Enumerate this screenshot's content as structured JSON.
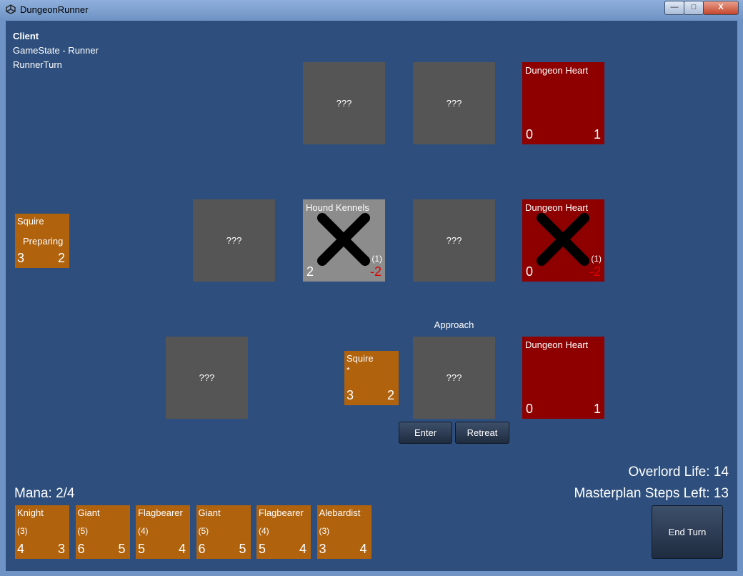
{
  "window": {
    "title": "DungeonRunner",
    "minimize": "—",
    "maximize": "□",
    "close": "X"
  },
  "hud": {
    "client": "Client",
    "game_state": "GameState - Runner",
    "turn": "RunnerTurn"
  },
  "rooms": {
    "r1c1": "???",
    "r1c2": "???",
    "r2c0": "???",
    "r2c2": "???",
    "r3c0": "???",
    "r3c2": "???",
    "hound_kennels": {
      "name": "Hound Kennels",
      "left": "2",
      "right": "-2",
      "extra": "(1)"
    },
    "heart_top": {
      "name": "Dungeon Heart",
      "left": "0",
      "right": "1"
    },
    "heart_mid": {
      "name": "Dungeon Heart",
      "left": "0",
      "right": "-2",
      "extra": "(1)"
    },
    "heart_bot": {
      "name": "Dungeon Heart",
      "left": "0",
      "right": "1"
    }
  },
  "prep_card": {
    "name": "Squire",
    "status": "Preparing",
    "left": "3",
    "right": "2"
  },
  "runner_card": {
    "name": "Squire",
    "mark": "*",
    "left": "3",
    "right": "2"
  },
  "approach_label": "Approach",
  "buttons": {
    "enter": "Enter",
    "retreat": "Retreat",
    "end_turn": "End Turn"
  },
  "stats": {
    "mana": "Mana: 2/4",
    "overlord_life": "Overlord Life: 14",
    "masterplan": "Masterplan Steps Left: 13"
  },
  "hand": [
    {
      "name": "Knight",
      "cost": "(3)",
      "left": "4",
      "right": "3"
    },
    {
      "name": "Giant",
      "cost": "(5)",
      "left": "6",
      "right": "5"
    },
    {
      "name": "Flagbearer",
      "cost": "(4)",
      "left": "5",
      "right": "4"
    },
    {
      "name": "Giant",
      "cost": "(5)",
      "left": "6",
      "right": "5"
    },
    {
      "name": "Flagbearer",
      "cost": "(4)",
      "left": "5",
      "right": "4"
    },
    {
      "name": "Alebardist",
      "cost": "(3)",
      "left": "3",
      "right": "4"
    }
  ],
  "colors": {
    "background": "#2e4f7d",
    "room": "#555555",
    "heart": "#8e0000",
    "card": "#b0620c",
    "negative": "#e00000"
  },
  "icons": {
    "app": "unity-icon",
    "destroyed": "x-mark-icon"
  }
}
